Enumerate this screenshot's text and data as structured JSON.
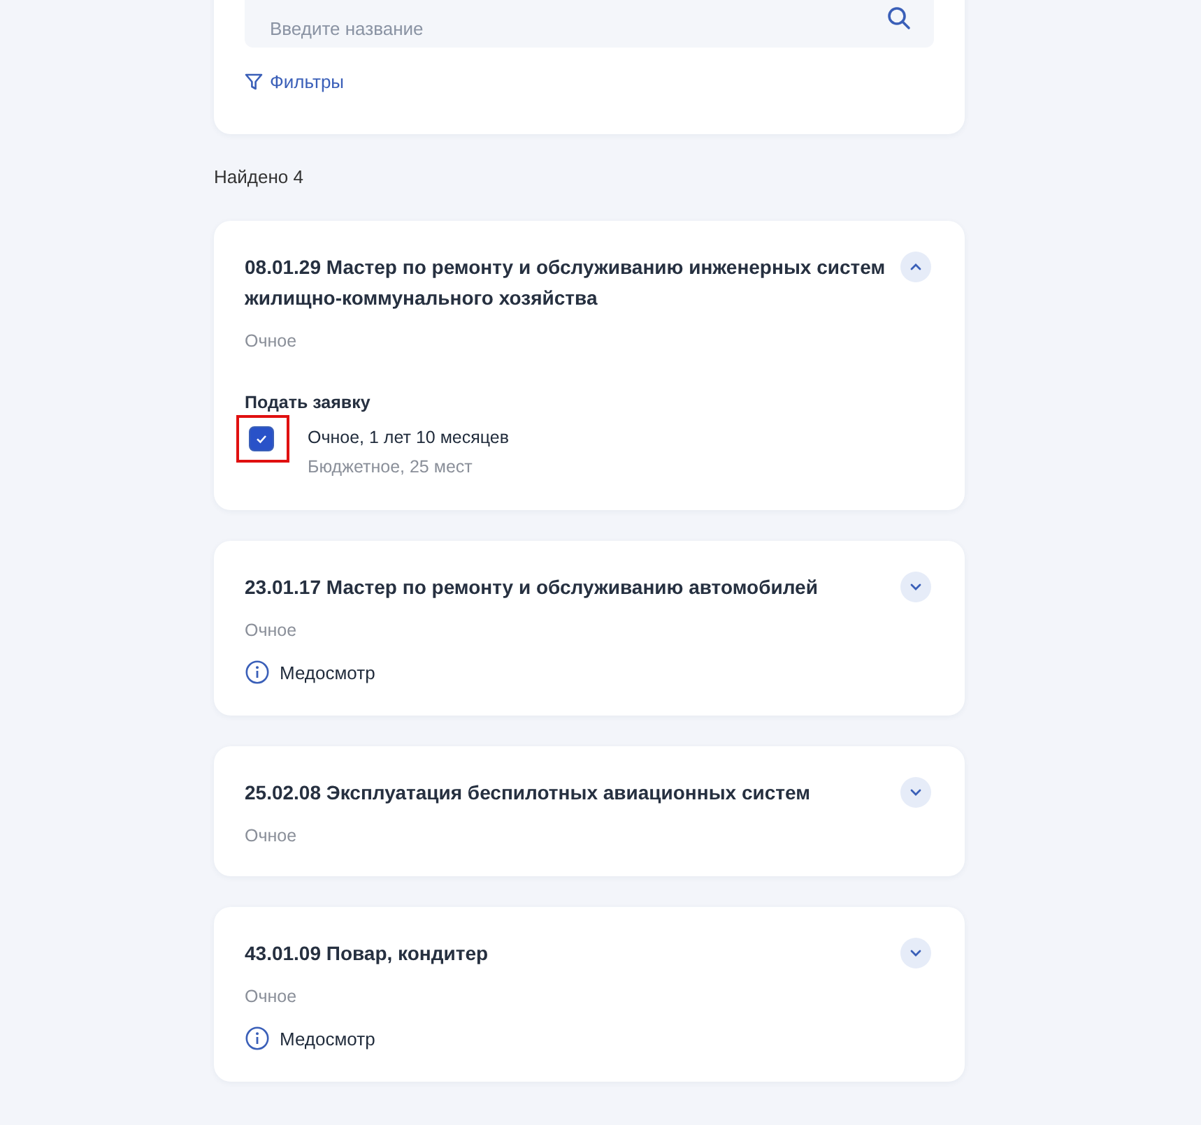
{
  "search": {
    "placeholder": "Введите название"
  },
  "filters_link": "Фильтры",
  "found": "Найдено 4",
  "programs": [
    {
      "title": "08.01.29 Мастер по ремонту и обслуживанию инженерных систем жилищно-коммунального хозяйства",
      "form": "Очное",
      "expanded": true,
      "apply_label": "Подать заявку",
      "options": [
        {
          "line1": "Очное, 1 лет 10 месяцев",
          "line2": "Бюджетное, 25 мест",
          "checked": true,
          "highlighted": true
        }
      ]
    },
    {
      "title": "23.01.17 Мастер по ремонту и обслуживанию автомобилей",
      "form": "Очное",
      "expanded": false,
      "note": "Медосмотр"
    },
    {
      "title": "25.02.08 Эксплуатация беспилотных авиационных систем",
      "form": "Очное",
      "expanded": false
    },
    {
      "title": "43.01.09 Повар, кондитер",
      "form": "Очное",
      "expanded": false,
      "note": "Медосмотр"
    }
  ]
}
